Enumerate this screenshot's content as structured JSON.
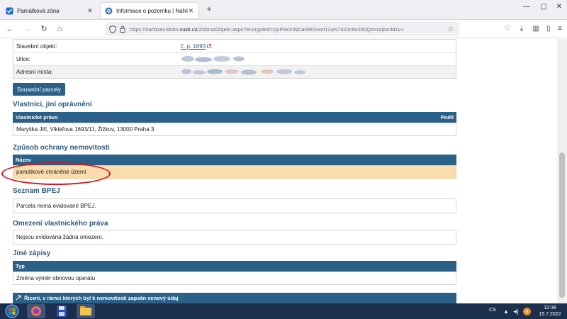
{
  "browser": {
    "tabs": [
      {
        "label": "Památková zóna",
        "active": false
      },
      {
        "label": "Informace o pozemku | Nahlíže",
        "active": true
      }
    ],
    "new_tab": "+",
    "window_controls": [
      "—",
      "▢",
      "✕"
    ],
    "url_prefix": "https://nahlizenidokn.",
    "url_domain": "cuzk.cz",
    "url_rest": "/ZobrazObjekt.aspx?encrypted=zjuPdxXINDaRRGvoII12aN74GIn6s260QImUqIonMzv-I",
    "star_icon": "☆"
  },
  "parcel_info": {
    "rows": [
      {
        "label": "Stavební objekt:",
        "value": "č. p. 1693"
      },
      {
        "label": "Ulice:",
        "value": ""
      },
      {
        "label": "Adresní místa:",
        "value": ""
      }
    ]
  },
  "buttons": {
    "neighbor_parcels": "Sousední parcely"
  },
  "owners": {
    "title": "Vlastníci, jiní oprávnění",
    "header_left": "Vlastnické právo",
    "header_right": "Podíl",
    "row": "Maryška Jiří, Viklefova 1693/11, Žižkov, 13000 Praha 3"
  },
  "protection": {
    "title": "Způsob ochrany nemovitosti",
    "header": "Název",
    "row": "památkově chráněné území"
  },
  "bpej": {
    "title": "Seznam BPEJ",
    "row": "Parcela nemá evidované BPEJ."
  },
  "restrictions": {
    "title": "Omezení vlastnického práva",
    "row": "Nejsou evidována žádná omezení."
  },
  "other_records": {
    "title": "Jiné zápisy",
    "header": "Typ",
    "row": "Změna výměr obnovou operátu"
  },
  "proceedings": {
    "header": "Řízení, v rámci kterých byl k nemovitosti zapsán cenový údaj"
  },
  "taskbar": {
    "language": "CS",
    "time": "12:38",
    "date": "15.7.2022"
  },
  "colors": {
    "header_blue": "#2b6088",
    "section_title": "#2d5a80",
    "highlight_row": "#fbdcae",
    "annotation_red": "#d9161b",
    "taskbar": "#1b2f4d"
  }
}
